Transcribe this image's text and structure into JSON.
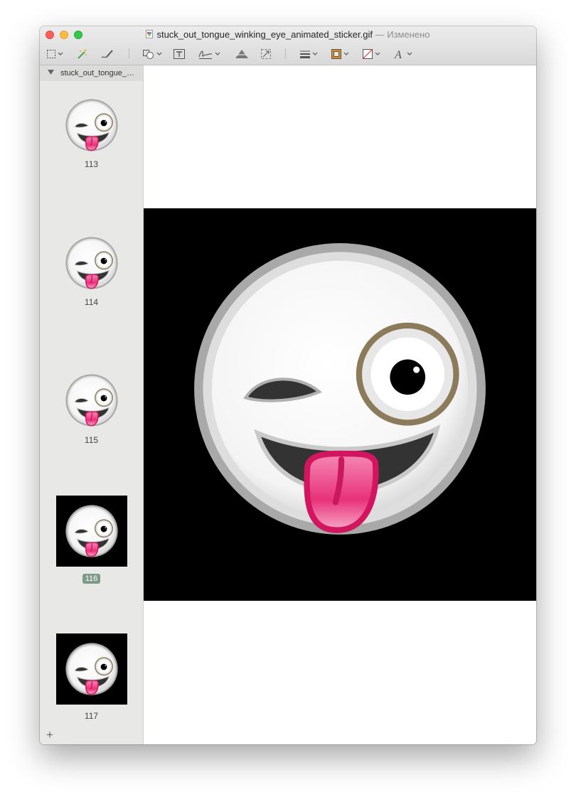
{
  "window": {
    "file_name": "stuck_out_tongue_winking_eye_animated_sticker.gif",
    "edited_text": "— Изменено"
  },
  "toolbar": {
    "tools": [
      "rect-selection-icon",
      "instant-alpha-icon",
      "sketch-icon",
      "shapes-icon",
      "text-icon",
      "sign-icon",
      "adjust-color-icon",
      "adjust-size-icon",
      "shape-style-icon",
      "border-color-icon",
      "fill-color-icon",
      "text-style-icon"
    ],
    "border_color": "#e0901e"
  },
  "sidebar": {
    "header": "stuck_out_tongue_winking_eye_animated_sticker",
    "frames": [
      {
        "label": "113",
        "selected": false,
        "background": "transparent"
      },
      {
        "label": "114",
        "selected": false,
        "background": "transparent"
      },
      {
        "label": "115",
        "selected": false,
        "background": "transparent"
      },
      {
        "label": "116",
        "selected": true,
        "background": "black"
      },
      {
        "label": "117",
        "selected": false,
        "background": "black"
      }
    ],
    "add_label": "+"
  },
  "colors": {
    "selection_badge": "#7d9a87",
    "tongue": "#e8327a",
    "monocle": "#8c7b5a"
  }
}
